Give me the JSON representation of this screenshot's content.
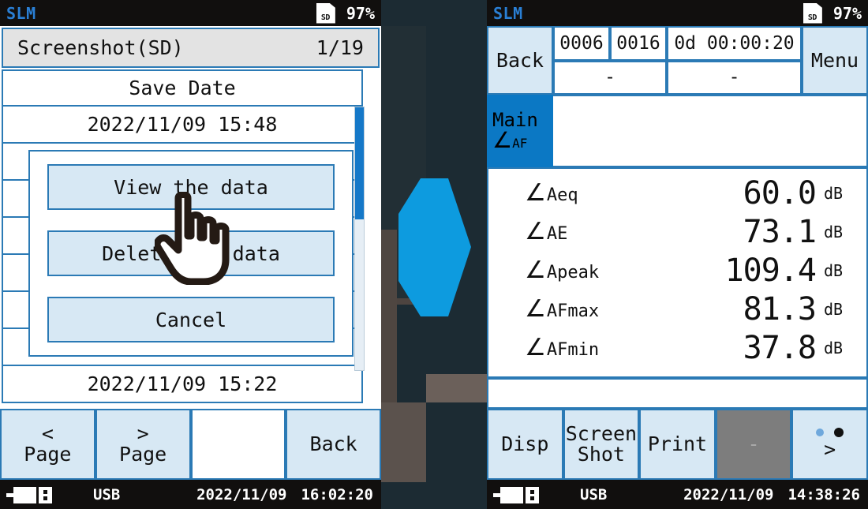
{
  "left": {
    "statusbar": {
      "app": "SLM",
      "storage_icon": "sd-card-icon",
      "storage_label": "SD",
      "battery": "97%"
    },
    "title": "Screenshot(SD)",
    "page_indicator": "1/19",
    "list_header": "Save Date",
    "rows": [
      "2022/11/09 15:48",
      "",
      "",
      "",
      "",
      "",
      "",
      "2022/11/09 15:22"
    ],
    "dialog": {
      "buttons": [
        {
          "label": "View the data",
          "name": "view-the-data-button"
        },
        {
          "label": "Delete the data",
          "name": "delete-the-data-button"
        },
        {
          "label": "Cancel",
          "name": "cancel-button"
        }
      ]
    },
    "softkeys": [
      {
        "line1": "<",
        "line2": "Page",
        "name": "prev-page-button",
        "style": "normal"
      },
      {
        "line1": ">",
        "line2": "Page",
        "name": "next-page-button",
        "style": "normal"
      },
      {
        "line1": "",
        "line2": "",
        "name": "empty-softkey",
        "style": "blank"
      },
      {
        "line1": "Back",
        "line2": "",
        "name": "back-button",
        "style": "normal"
      }
    ],
    "bottombar": {
      "connection": "USB",
      "date": "2022/11/09",
      "time": "16:02:20"
    }
  },
  "right": {
    "statusbar": {
      "app": "SLM",
      "storage_icon": "sd-card-icon",
      "storage_label": "SD",
      "battery": "97%"
    },
    "back_label": "Back",
    "menu_label": "Menu",
    "header_cells_top": [
      "0006",
      "0016",
      "0d 00:00:20"
    ],
    "header_cells_bottom": [
      "-",
      "-"
    ],
    "tab": {
      "line1": "Main",
      "line2": "AF",
      "symbol": "∠"
    },
    "measurements": [
      {
        "symbol": "∠",
        "sub": "Aeq",
        "value": "60.0",
        "unit": "dB"
      },
      {
        "symbol": "∠",
        "sub": "AE",
        "value": "73.1",
        "unit": "dB"
      },
      {
        "symbol": "∠",
        "sub": "Apeak",
        "value": "109.4",
        "unit": "dB"
      },
      {
        "symbol": "∠",
        "sub": "AFmax",
        "value": "81.3",
        "unit": "dB"
      },
      {
        "symbol": "∠",
        "sub": "AFmin",
        "value": "37.8",
        "unit": "dB"
      }
    ],
    "softkeys": [
      {
        "line1": "Disp",
        "line2": "",
        "name": "disp-button",
        "style": "normal"
      },
      {
        "line1": "Screen",
        "line2": "Shot",
        "name": "screen-shot-button",
        "style": "normal"
      },
      {
        "line1": "Print",
        "line2": "",
        "name": "print-button",
        "style": "normal"
      },
      {
        "line1": "-",
        "line2": "",
        "name": "disabled-softkey",
        "style": "dim"
      },
      {
        "line1": ">",
        "line2": "",
        "name": "next-softkey-page-button",
        "style": "dots"
      }
    ],
    "page_dots": [
      "#6fa8dc",
      "#111111"
    ],
    "bottombar": {
      "connection": "USB",
      "date": "2022/11/09",
      "time": "14:38:26"
    }
  },
  "center": {
    "arrow_icon": "right-arrow-icon",
    "arrow_color": "#0d9bdf"
  },
  "colors": {
    "accent_blue": "#2b7ab5",
    "button_fill": "#d7e8f4",
    "tab_blue": "#0b78c4",
    "arrow_blue": "#0d9bdf",
    "statusbar_bg": "#110f0e"
  }
}
